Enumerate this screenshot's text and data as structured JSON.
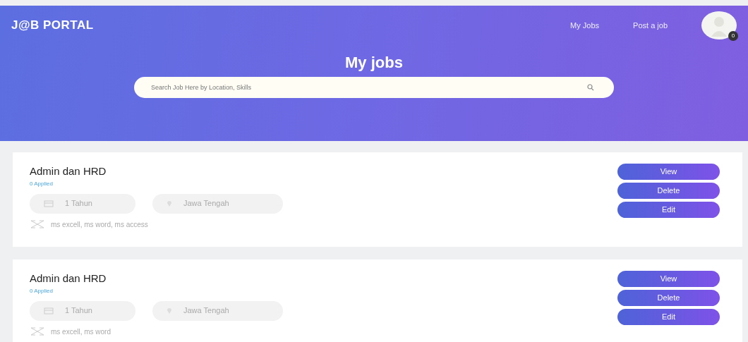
{
  "brand": "J@B PORTAL",
  "nav": [
    {
      "label": "My Jobs"
    },
    {
      "label": "Post a job"
    }
  ],
  "avatar": {
    "badge": "0"
  },
  "hero": {
    "title": "My jobs",
    "search": {
      "placeholder": "Search Job Here by Location, Skills"
    }
  },
  "jobs": [
    {
      "title": "Admin dan HRD",
      "applied": "0 Applied",
      "experience": "1 Tahun",
      "location": "Jawa Tengah",
      "skills": "ms excell, ms word, ms access",
      "buttons": [
        "View",
        "Delete",
        "Edit"
      ]
    },
    {
      "title": "Admin dan HRD",
      "applied": "0 Applied",
      "experience": "1 Tahun",
      "location": "Jawa Tengah",
      "skills": "ms excell, ms word",
      "buttons": [
        "View",
        "Delete",
        "Edit"
      ]
    }
  ]
}
